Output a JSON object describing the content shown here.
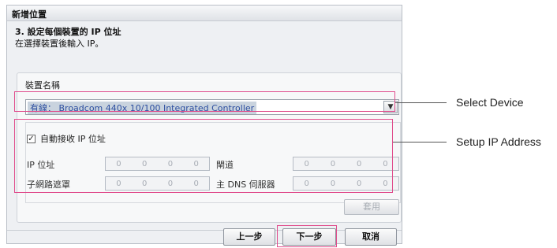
{
  "dialog": {
    "title": "新增位置",
    "step_title": "3. 設定每個裝置的 IP 位址",
    "step_desc": "在選擇裝置後輸入 IP。"
  },
  "device": {
    "label": "裝置名稱",
    "selected": "有線： Broadcom 440x 10/100 Integrated Controller"
  },
  "ip_settings": {
    "auto_label": "自動接收 IP 位址",
    "auto_checked": true,
    "checkmark": "✓",
    "ip_label": "IP 位址",
    "subnet_label": "子網路遮罩",
    "gateway_label": "閘道",
    "dns_label": "主 DNS 伺服器",
    "octet_placeholder": "0"
  },
  "buttons": {
    "apply": "套用",
    "back": "上一步",
    "next": "下一步",
    "cancel": "取消"
  },
  "callouts": {
    "select_device": "Select Device",
    "setup_ip": "Setup IP Address"
  },
  "colors": {
    "highlight_border": "#e04c8c",
    "selection_bg": "#c9d3de"
  }
}
